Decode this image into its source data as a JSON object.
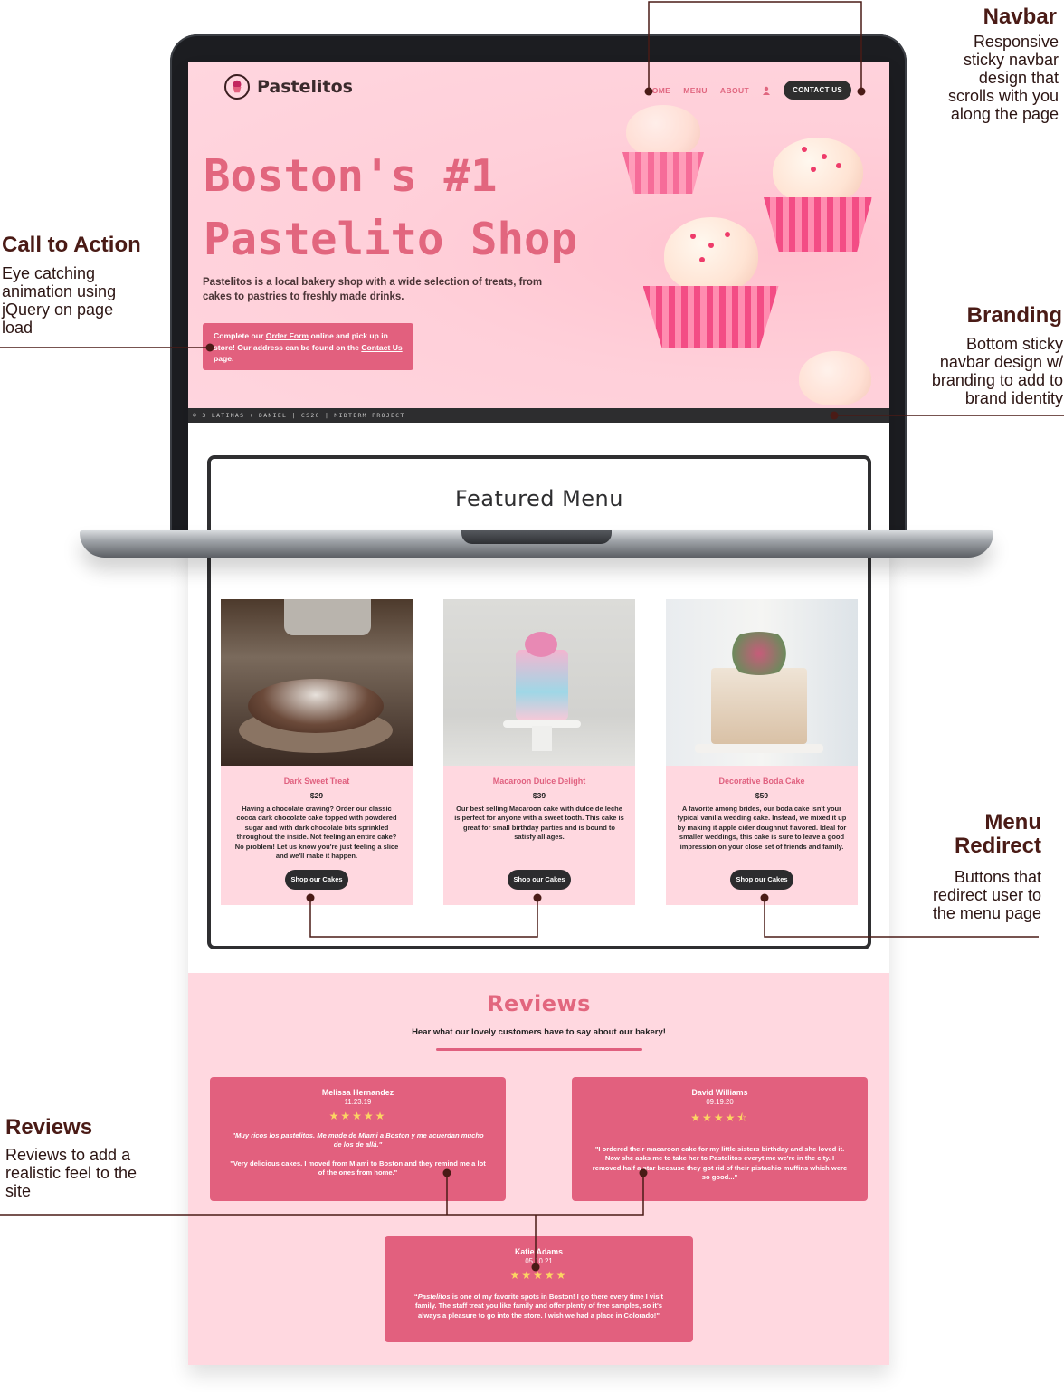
{
  "site": {
    "brand": "Pastelitos",
    "nav": {
      "home": "HOME",
      "menu": "MENU",
      "about": "ABOUT",
      "contact": "CONTACT US"
    },
    "hero": {
      "title_line1": "Boston's #1",
      "title_line2": "Pastelito Shop",
      "description": "Pastelitos is a local bakery shop with a wide selection of treats, from cakes to pastries to freshly made drinks.",
      "cta_part1": "Complete our ",
      "cta_link1": "Order Form",
      "cta_part2": " online and pick up in store! Our address can be found on the ",
      "cta_link2": "Contact Us",
      "cta_part3": " page."
    },
    "footer": "© 3 LATINAS + DANIEL | CS20 | MIDTERM PROJECT",
    "featured": {
      "title": "Featured Menu",
      "items": [
        {
          "name": "Dark Sweet Treat",
          "price": "$29",
          "description": "Having a chocolate craving? Order our classic cocoa dark chocolate cake topped with powdered sugar and with dark chocolate bits sprinkled throughout the inside. Not feeling an entire cake? No problem! Let us know you're just feeling a slice and we'll make it happen.",
          "button": "Shop our Cakes"
        },
        {
          "name": "Macaroon Dulce Delight",
          "price": "$39",
          "description": "Our best selling Macaroon cake with dulce de leche is perfect for anyone with a sweet tooth. This cake is great for small birthday parties and is bound to satisfy all ages.",
          "button": "Shop our Cakes"
        },
        {
          "name": "Decorative Boda Cake",
          "price": "$59",
          "description": "A favorite among brides, our boda cake isn't your typical vanilla wedding cake. Instead, we mixed it up by making it apple cider doughnut flavored. Ideal for smaller weddings, this cake is sure to leave a good impression on your close set of friends and family.",
          "button": "Shop our Cakes"
        }
      ]
    },
    "reviews": {
      "title": "Reviews",
      "subtitle": "Hear what our lovely customers have to say about our bakery!",
      "items": [
        {
          "name": "Melissa Hernandez",
          "date": "11.23.19",
          "stars": "★★★★★",
          "quote": "\"Muy ricos los pastelitos. Me mude de Miami a Boston y me acuerdan mucho de los de allá.\"",
          "body": "\"Very delicious cakes. I moved from Miami to Boston and they remind me a lot of the ones from home.\""
        },
        {
          "name": "David Williams",
          "date": "09.19.20",
          "stars": "★★★★⯪",
          "body": "\"I ordered their macaroon cake for my little sisters birthday and she loved it. Now she asks me to take her to Pastelitos everytime we're in the city. I removed half a star because they got rid of their pistachio muffins which were so good...\""
        },
        {
          "name": "Katie Adams",
          "date": "05.10.21",
          "stars": "★★★★★",
          "body_italic": "Pastelitos",
          "body": " is one of my favorite spots in Boston! I go there every time I visit family. The staff treat you like family and offer plenty of free samples, so it's always a pleasure to go into the store. I wish we had a place in Colorado!\""
        }
      ]
    }
  },
  "annotations": {
    "navbar": {
      "title": "Navbar",
      "text": [
        "Responsive",
        "sticky navbar",
        "design that",
        "scrolls with you",
        "along the page"
      ]
    },
    "cta": {
      "title": "Call to Action",
      "text": [
        "Eye catching",
        "animation using",
        "jQuery on page",
        "load"
      ]
    },
    "branding": {
      "title": "Branding",
      "text": [
        "Bottom sticky",
        "navbar design w/",
        "branding to add to",
        "brand identity"
      ]
    },
    "menu_redirect": {
      "title_line1": "Menu",
      "title_line2": "Redirect",
      "text": [
        "Buttons that",
        "redirect user to",
        "the menu page"
      ]
    },
    "reviews": {
      "title": "Reviews",
      "text": [
        "Reviews to add a",
        "realistic feel to the",
        "site"
      ]
    }
  },
  "colors": {
    "brand_pink": "#e2607e",
    "light_pink": "#ffd8e0",
    "annotation": "#4a1b16",
    "dark": "#2c2c2e",
    "star": "#fbd563"
  }
}
